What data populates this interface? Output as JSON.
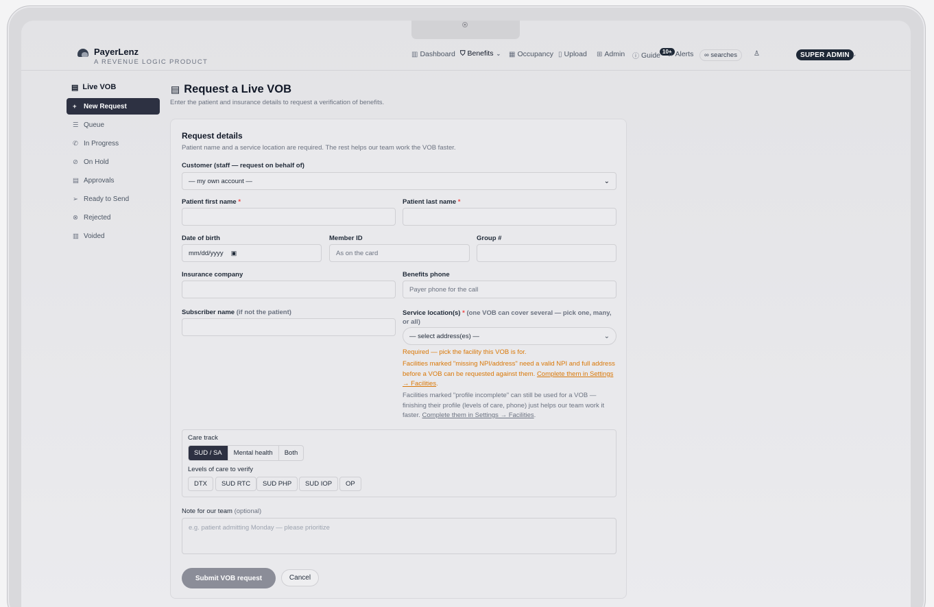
{
  "brand": {
    "name": "PayerLenz",
    "tagline": "A REVENUE LOGIC PRODUCT"
  },
  "nav": {
    "dashboard": "Dashboard",
    "benefits": "Benefits",
    "occupancy": "Occupancy",
    "upload": "Upload",
    "admin": "Admin",
    "guide": "Guide",
    "alerts_badge": "10+",
    "alerts": "Alerts",
    "searches": "∞ searches",
    "role": "SUPER ADMIN"
  },
  "sidebar": {
    "title": "Live VOB",
    "items": [
      {
        "label": "New Request",
        "icon": "plus-icon",
        "glyph": "+"
      },
      {
        "label": "Queue",
        "icon": "list-check-icon",
        "glyph": "☰"
      },
      {
        "label": "In Progress",
        "icon": "phone-icon",
        "glyph": "✆"
      },
      {
        "label": "On Hold",
        "icon": "pause-circle-icon",
        "glyph": "⊘"
      },
      {
        "label": "Approvals",
        "icon": "clipboard-check-icon",
        "glyph": "▤"
      },
      {
        "label": "Ready to Send",
        "icon": "send-icon",
        "glyph": "➢"
      },
      {
        "label": "Rejected",
        "icon": "x-circle-icon",
        "glyph": "⊗"
      },
      {
        "label": "Voided",
        "icon": "trash-icon",
        "glyph": "▥"
      }
    ]
  },
  "page": {
    "title": "Request a Live VOB",
    "subtitle": "Enter the patient and insurance details to request a verification of benefits."
  },
  "form": {
    "heading": "Request details",
    "subheading": "Patient name and a service location are required. The rest helps our team work the VOB faster.",
    "customer_label": "Customer (staff — request on behalf of)",
    "customer_value": "— my own account —",
    "first_name_label": "Patient first name",
    "last_name_label": "Patient last name",
    "required_mark": "*",
    "dob_label": "Date of birth",
    "dob_placeholder": "mm/dd/yyyy",
    "member_id_label": "Member ID",
    "member_id_placeholder": "As on the card",
    "group_label": "Group #",
    "insurance_label": "Insurance company",
    "benefits_phone_label": "Benefits phone",
    "benefits_phone_placeholder": "Payer phone for the call",
    "subscriber_label": "Subscriber name",
    "subscriber_hint": "(if not the patient)",
    "service_location_label": "Service location(s)",
    "service_location_hint": "(one VOB can cover several — pick one, many, or all)",
    "service_location_value": "— select address(es) —",
    "warn_required": "Required — pick the facility this VOB is for.",
    "warn_missing_npi": "Facilities marked \"missing NPI/address\" need a valid NPI and full address before a VOB can be requested against them.",
    "warn_link": "Complete them in Settings → Facilities",
    "info_incomplete": "Facilities marked \"profile incomplete\" can still be used for a VOB — finishing their profile (levels of care, phone) just helps our team work it faster.",
    "info_link": "Complete them in Settings → Facilities",
    "care_track_label": "Care track",
    "care_tracks": [
      "SUD / SA",
      "Mental health",
      "Both"
    ],
    "levels_label": "Levels of care to verify",
    "levels": [
      "DTX",
      "SUD RTC",
      "SUD PHP",
      "SUD IOP",
      "OP"
    ],
    "note_label": "Note for our team",
    "note_hint": "(optional)",
    "note_placeholder": "e.g. patient admitting Monday — please prioritize",
    "submit": "Submit VOB request",
    "cancel": "Cancel"
  }
}
